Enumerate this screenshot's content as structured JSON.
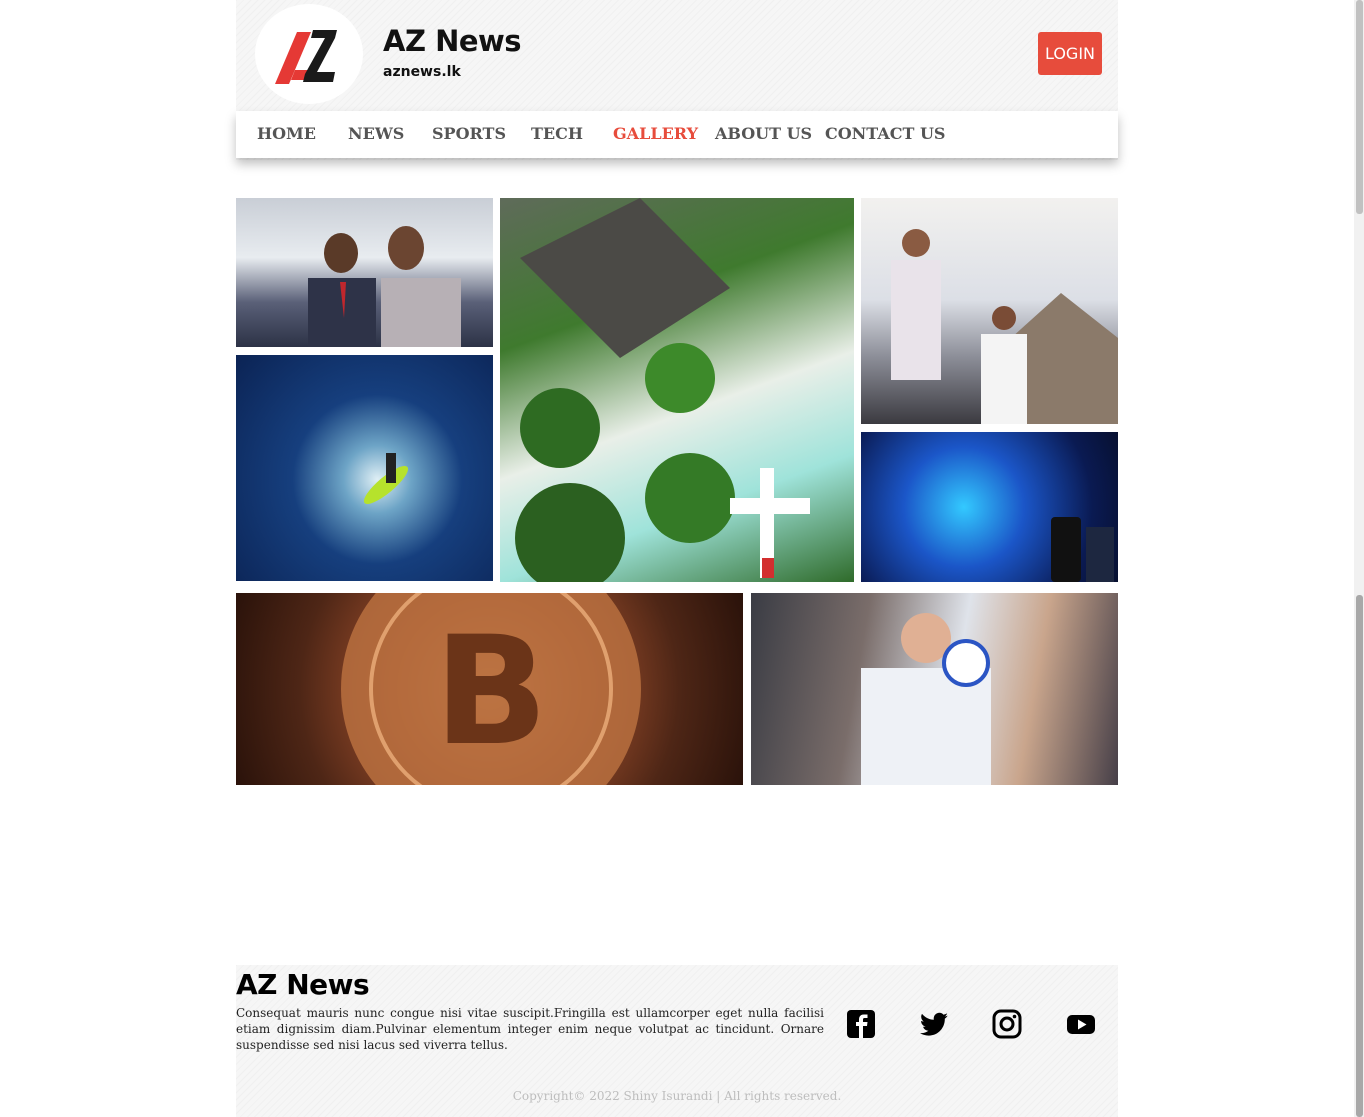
{
  "header": {
    "title": "AZ News",
    "subtitle": "aznews.lk",
    "login_label": "LOGIN",
    "logo_icon": "az-logo-icon"
  },
  "nav": {
    "items": [
      {
        "label": "HOME"
      },
      {
        "label": "NEWS"
      },
      {
        "label": "SPORTS"
      },
      {
        "label": "TECH"
      },
      {
        "label": "GALLERY",
        "active": true
      },
      {
        "label": "ABOUT US"
      },
      {
        "label": "CONTACT US"
      }
    ]
  },
  "gallery": {
    "photos": [
      {
        "name": "business-people-photo"
      },
      {
        "name": "beach-resort-photo"
      },
      {
        "name": "concert-photo"
      },
      {
        "name": "surfer-photo"
      },
      {
        "name": "monitor-photo"
      },
      {
        "name": "bitcoin-photo"
      },
      {
        "name": "football-player-photo"
      }
    ]
  },
  "footer": {
    "title": "AZ News",
    "text": "Consequat mauris nunc congue nisi vitae suscipit.Fringilla est ullamcorper eget nulla facilisi etiam dignissim diam.Pulvinar elementum integer enim neque volutpat ac tincidunt. Ornare suspendisse sed nisi lacus sed viverra tellus.",
    "social": [
      "facebook-icon",
      "twitter-icon",
      "instagram-icon",
      "youtube-icon"
    ],
    "copyright": "Copyright© 2022 Shiny Isurandi | All rights reserved."
  },
  "colors": {
    "accent": "#e74c3c",
    "nav_text": "#555555"
  }
}
